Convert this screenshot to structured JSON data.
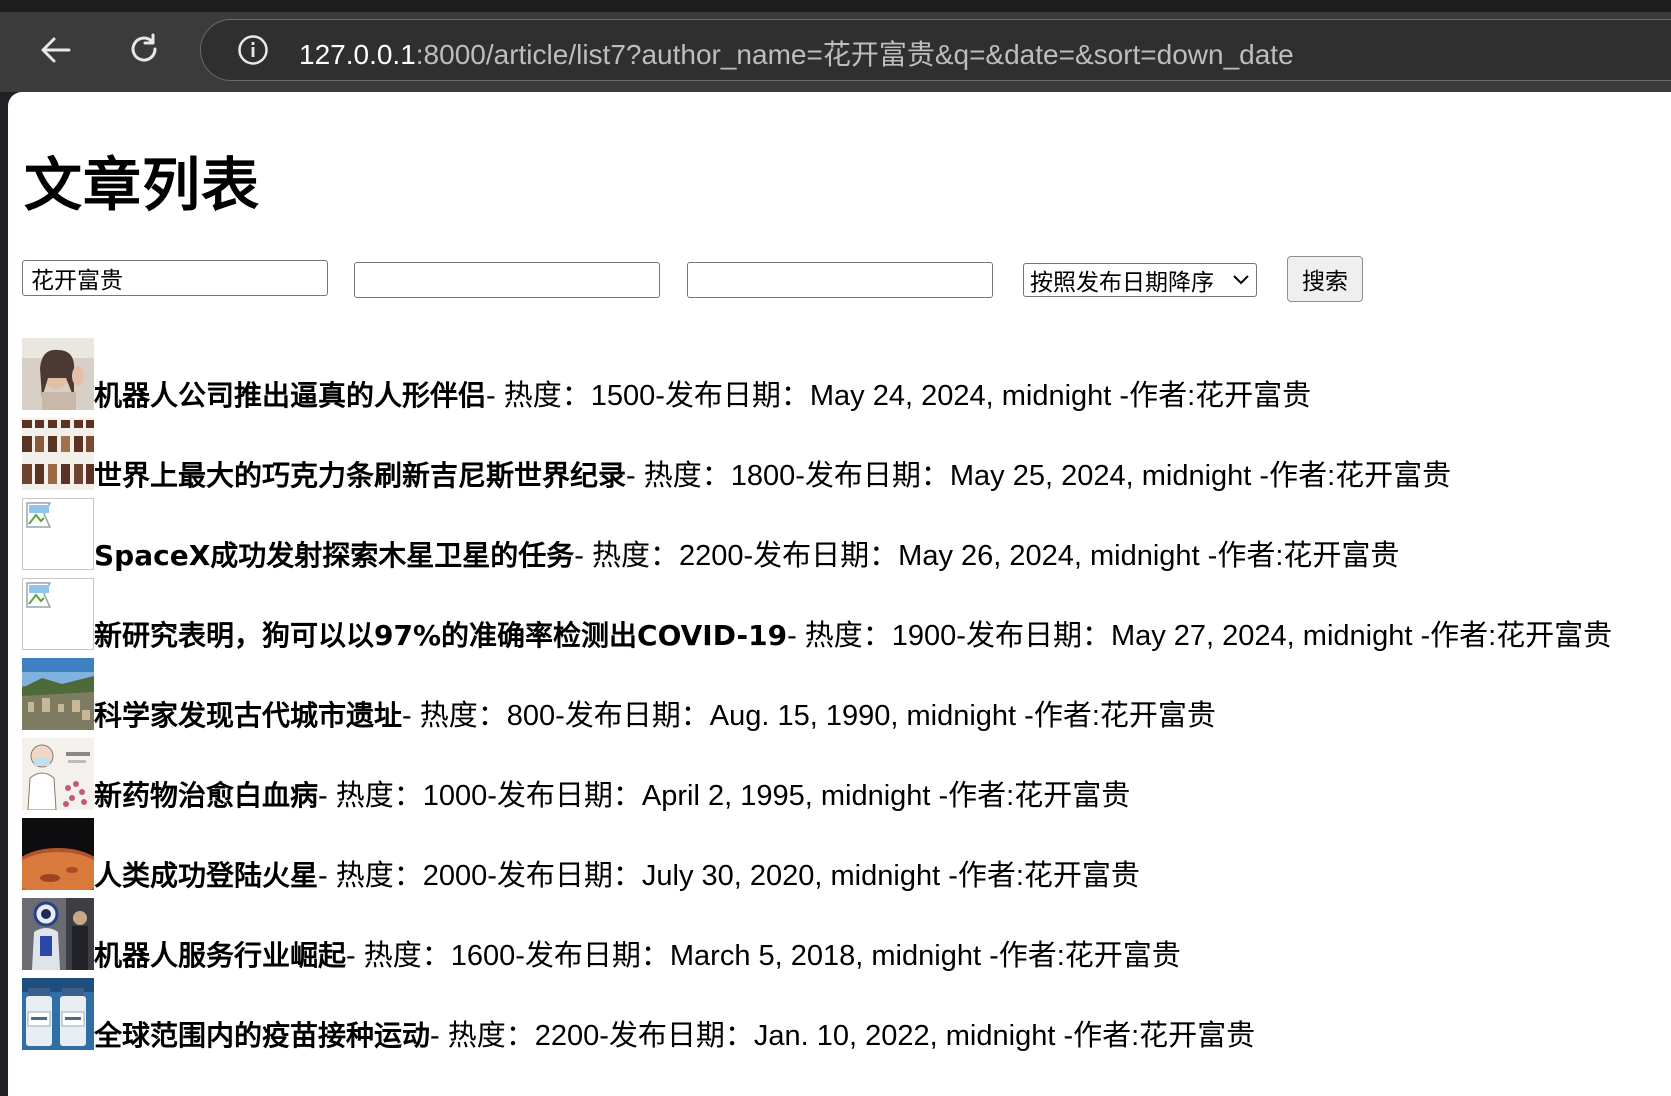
{
  "browser": {
    "url_host": "127.0.0.1",
    "url_rest": ":8000/article/list7?author_name=花开富贵&q=&date=&sort=down_date"
  },
  "page": {
    "title": "文章列表"
  },
  "search": {
    "author_value": "花开富贵",
    "q_value": "",
    "date_value": "",
    "sort_selected": "按照发布日期降序",
    "button_label": "搜索"
  },
  "articles": [
    {
      "title": "机器人公司推出逼真的人形伴侣",
      "meta": "- 热度：1500-发布日期：May 24, 2024, midnight -作者:花开富贵",
      "thumb": "photo-woman"
    },
    {
      "title": "世界上最大的巧克力条刷新吉尼斯世界纪录",
      "meta": "- 热度：1800-发布日期：May 25, 2024, midnight -作者:花开富贵",
      "thumb": "photo-grid"
    },
    {
      "title": "SpaceX成功发射探索木星卫星的任务",
      "meta": "- 热度：2200-发布日期：May 26, 2024, midnight -作者:花开富贵",
      "thumb": "broken"
    },
    {
      "title": "新研究表明，狗可以以97%的准确率检测出COVID-19",
      "meta": "- 热度：1900-发布日期：May 27, 2024, midnight -作者:花开富贵",
      "thumb": "broken"
    },
    {
      "title": "科学家发现古代城市遗址",
      "meta": "- 热度：800-发布日期：Aug. 15, 1990, midnight -作者:花开富贵",
      "thumb": "photo-ruins"
    },
    {
      "title": "新药物治愈白血病",
      "meta": "- 热度：1000-发布日期：April 2, 1995, midnight -作者:花开富贵",
      "thumb": "photo-illustration"
    },
    {
      "title": "人类成功登陆火星",
      "meta": "- 热度：2000-发布日期：July 30, 2020, midnight -作者:花开富贵",
      "thumb": "photo-mars"
    },
    {
      "title": "机器人服务行业崛起",
      "meta": "- 热度：1600-发布日期：March 5, 2018, midnight -作者:花开富贵",
      "thumb": "photo-robot"
    },
    {
      "title": "全球范围内的疫苗接种运动",
      "meta": "- 热度：2200-发布日期：Jan. 10, 2022, midnight -作者:花开富贵",
      "thumb": "photo-vaccine"
    }
  ]
}
